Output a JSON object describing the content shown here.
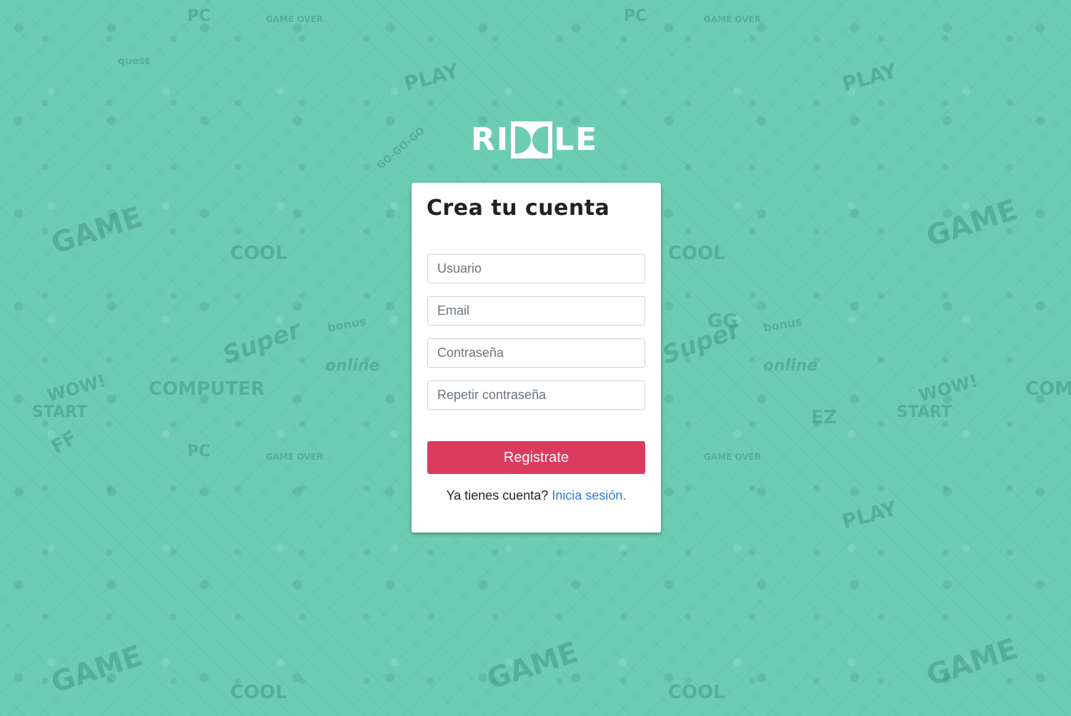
{
  "app": {
    "logo_text_left": "RI",
    "logo_text_right": "LE",
    "background_color": "#6ccdb2",
    "accent_color": "#dc3b60",
    "link_color": "#2f7bd9"
  },
  "background_doodles": [
    "GAME",
    "PLAY",
    "COMPUTER",
    "START",
    "GAME OVER",
    "bonus",
    "COOL",
    "WOW!",
    "GO-GO-GO",
    "Super",
    "online",
    "quest",
    "EZ",
    "GG",
    "FF",
    "PC"
  ],
  "form": {
    "title": "Crea tu cuenta",
    "fields": [
      {
        "placeholder": "Usuario",
        "value": ""
      },
      {
        "placeholder": "Email",
        "value": ""
      },
      {
        "placeholder": "Contraseña",
        "value": ""
      },
      {
        "placeholder": "Repetir contraseña",
        "value": ""
      }
    ],
    "submit_label": "Registrate",
    "login_prompt": "Ya tienes cuenta? ",
    "login_link": "Inicia sesión",
    "login_suffix": "."
  }
}
